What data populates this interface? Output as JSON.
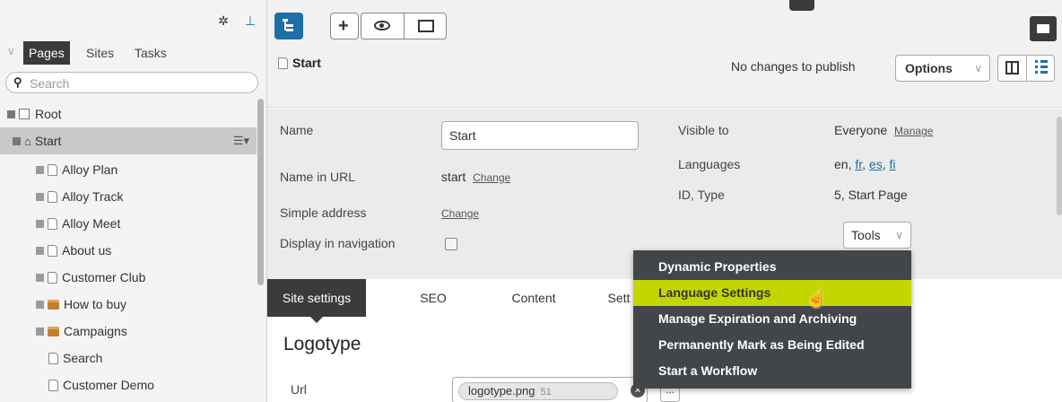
{
  "left_pane": {
    "tabs": [
      "Pages",
      "Sites",
      "Tasks"
    ],
    "search_placeholder": "Search",
    "tree": [
      {
        "label": "Root"
      },
      {
        "label": "Start"
      },
      {
        "label": "Alloy Plan"
      },
      {
        "label": "Alloy Track"
      },
      {
        "label": "Alloy Meet"
      },
      {
        "label": "About us"
      },
      {
        "label": "Customer Club"
      },
      {
        "label": "How to buy"
      },
      {
        "label": "Campaigns"
      },
      {
        "label": "Search"
      },
      {
        "label": "Customer Demo"
      }
    ]
  },
  "header": {
    "page_title": "Start",
    "publish_status": "No changes to publish",
    "options_label": "Options"
  },
  "properties": {
    "name_label": "Name",
    "name_value": "Start",
    "url_label": "Name in URL",
    "url_value": "start",
    "change_label": "Change",
    "simple_address_label": "Simple address",
    "display_nav_label": "Display in navigation",
    "visible_to_label": "Visible to",
    "visible_to_value": "Everyone",
    "manage_label": "Manage",
    "languages_label": "Languages",
    "languages": [
      "en",
      "fr",
      "es",
      "fi"
    ],
    "id_type_label": "ID, Type",
    "id_type_value": "5, Start Page",
    "tools_label": "Tools"
  },
  "tabs": [
    "Site settings",
    "SEO",
    "Content",
    "Sett"
  ],
  "tools_menu": [
    "Dynamic Properties",
    "Language Settings",
    "Manage Expiration and Archiving",
    "Permanently Mark as Being Edited",
    "Start a Workflow"
  ],
  "content": {
    "section_title": "Logotype",
    "url_label": "Url",
    "file_name": "logotype.png",
    "file_size": "51",
    "browse_label": "..."
  },
  "colors": {
    "accent_blue": "#1d6fa5",
    "menu_bg": "#424549",
    "menu_highlight": "#c3d600",
    "dark_tab": "#3b3b3b"
  }
}
